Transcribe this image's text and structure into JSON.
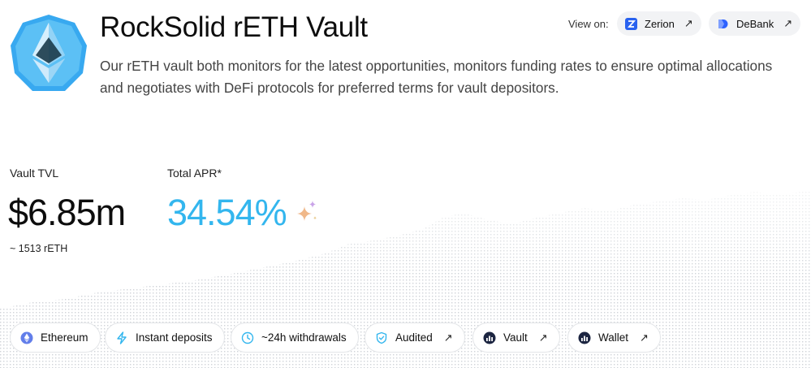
{
  "header": {
    "title": "RockSolid rETH Vault",
    "description": "Our rETH vault both monitors for the latest opportunities, monitors funding rates to ensure optimal allocations and negotiates with DeFi protocols for preferred terms for vault depositors."
  },
  "view_on": {
    "label": "View on:",
    "links": [
      {
        "label": "Zerion",
        "icon": "zerion-icon",
        "arrow": "↗"
      },
      {
        "label": "DeBank",
        "icon": "debank-icon",
        "arrow": "↗"
      }
    ]
  },
  "stats": {
    "tvl": {
      "label": "Vault TVL",
      "value": "$6.85m",
      "sub": "~ 1513 rETH"
    },
    "apr": {
      "label": "Total APR*",
      "value": "34.54%"
    }
  },
  "features": [
    {
      "label": "Ethereum",
      "icon": "ethereum-icon"
    },
    {
      "label": "Instant deposits",
      "icon": "lightning-icon"
    },
    {
      "label": "~24h withdrawals",
      "icon": "clock-icon"
    },
    {
      "label": "Audited",
      "icon": "shield-check-icon",
      "arrow": "↗"
    },
    {
      "label": "Vault",
      "icon": "chart-icon",
      "arrow": "↗"
    },
    {
      "label": "Wallet",
      "icon": "chart-icon",
      "arrow": "↗"
    }
  ],
  "colors": {
    "accent_apr": "#33b6ee",
    "logo_blue": "#38a9f0",
    "zerion_blue": "#2962ef",
    "debank_blue": "#2e62ff"
  }
}
